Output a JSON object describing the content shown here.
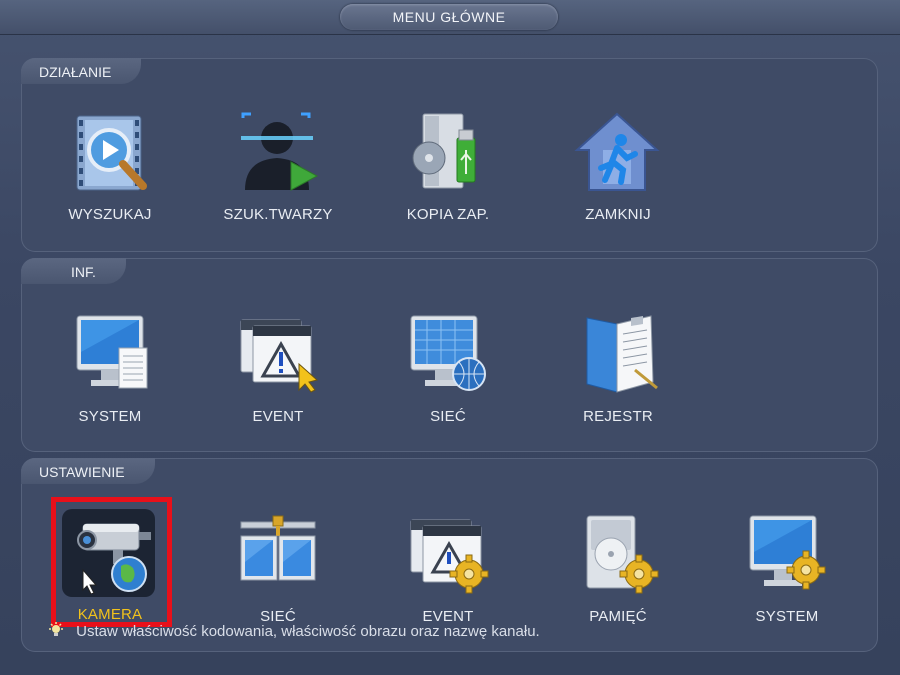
{
  "window": {
    "title": "MENU GŁÓWNE"
  },
  "sections": [
    {
      "label": "DZIAŁANIE",
      "items": [
        {
          "label": "WYSZUKAJ",
          "icon": "search-video-icon"
        },
        {
          "label": "SZUK.TWARZY",
          "icon": "face-search-icon"
        },
        {
          "label": "KOPIA ZAP.",
          "icon": "backup-icon"
        },
        {
          "label": "ZAMKNIJ",
          "icon": "exit-icon"
        }
      ]
    },
    {
      "label": "INF.",
      "items": [
        {
          "label": "SYSTEM",
          "icon": "system-info-icon"
        },
        {
          "label": "EVENT",
          "icon": "event-info-icon"
        },
        {
          "label": "SIEĆ",
          "icon": "network-info-icon"
        },
        {
          "label": "REJESTR",
          "icon": "log-icon"
        }
      ]
    },
    {
      "label": "USTAWIENIE",
      "items": [
        {
          "label": "KAMERA",
          "icon": "camera-settings-icon",
          "selected": true
        },
        {
          "label": "SIEĆ",
          "icon": "network-settings-icon"
        },
        {
          "label": "EVENT",
          "icon": "event-settings-icon"
        },
        {
          "label": "PAMIĘĆ",
          "icon": "storage-settings-icon"
        },
        {
          "label": "SYSTEM",
          "icon": "system-settings-icon"
        }
      ]
    }
  ],
  "hint": "Ustaw właściwość kodowania, właściwość obrazu oraz nazwę kanału.",
  "colors": {
    "selected_border": "#e8101a",
    "selected_label": "#f2c21b",
    "panel": "#3f4b66"
  }
}
